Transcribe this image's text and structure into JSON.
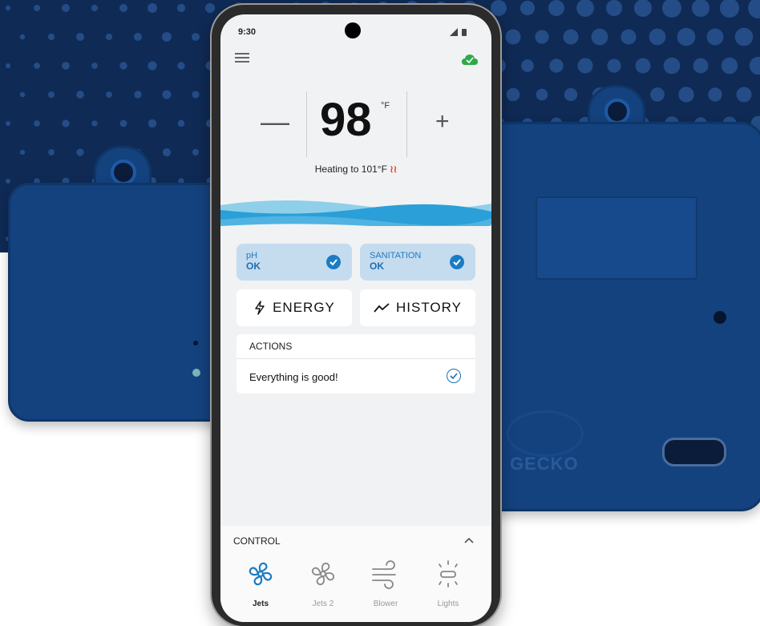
{
  "status": {
    "time": "9:30"
  },
  "temperature": {
    "value": "98",
    "unit": "°F",
    "minus": "—",
    "plus": "+",
    "heating_text": "Heating to 101°F",
    "heating_icon": "heat-waves-icon"
  },
  "chips": {
    "ph": {
      "label": "pH",
      "value": "OK"
    },
    "sanitation": {
      "label": "SANITATION",
      "value": "OK"
    }
  },
  "buttons": {
    "energy": "ENERGY",
    "history": "HISTORY"
  },
  "actions": {
    "title": "ACTIONS",
    "message": "Everything is good!"
  },
  "control": {
    "title": "CONTROL",
    "items": [
      {
        "label": "Jets",
        "icon": "fan-icon",
        "active": true
      },
      {
        "label": "Jets 2",
        "icon": "fan-icon",
        "active": false
      },
      {
        "label": "Blower",
        "icon": "wind-icon",
        "active": false
      },
      {
        "label": "Lights",
        "icon": "light-icon",
        "active": false
      }
    ]
  },
  "hardware": {
    "brand": "GECKO"
  },
  "colors": {
    "accent": "#1b7cc4",
    "background_band": "#0f2a55",
    "module": "#14427f",
    "heat": "#e8452c"
  }
}
